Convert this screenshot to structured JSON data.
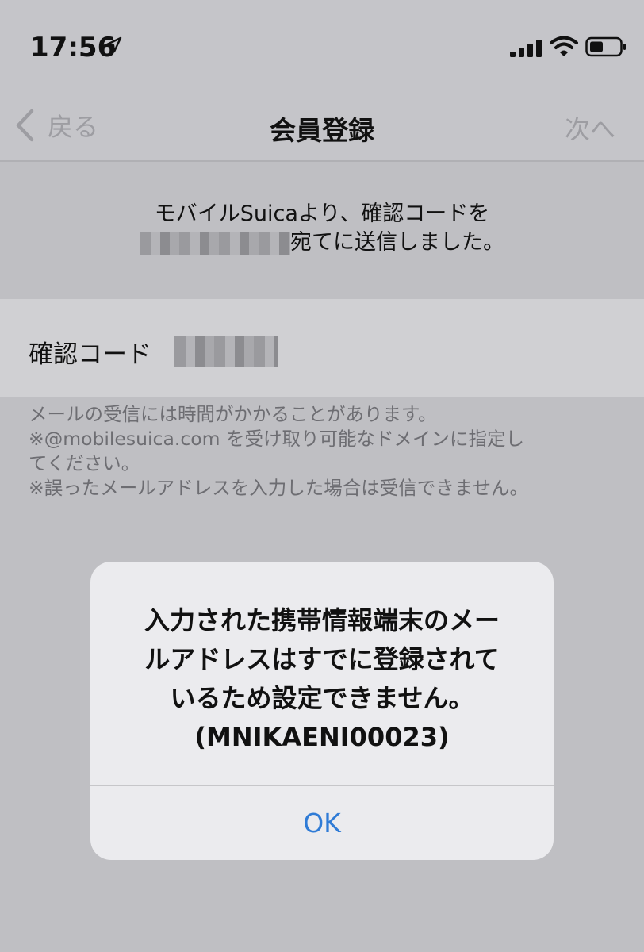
{
  "status_bar": {
    "time": "17:56",
    "icons": [
      "location-arrow-icon",
      "cellular-signal-icon",
      "wifi-icon",
      "battery-icon"
    ]
  },
  "nav": {
    "back_label": "戻る",
    "title": "会員登録",
    "next_label": "次へ"
  },
  "notice": {
    "line1": "モバイルSuicaより、確認コードを",
    "line2_suffix": "宛てに送信しました。"
  },
  "field": {
    "label": "確認コード"
  },
  "help": {
    "line1": "メールの受信には時間がかかることがあります。",
    "line2": "※@mobilesuica.com を受け取り可能なドメインに指定し",
    "line3": "てください。",
    "line4": "※誤ったメールアドレスを入力した場合は受信できません。"
  },
  "alert": {
    "line1": "入力された携帯情報端末のメー",
    "line2": "ルアドレスはすでに登録されて",
    "line3": "いるため設定できません。",
    "line4": "(MNIKAENI00023)",
    "ok_label": "OK"
  },
  "colors": {
    "background": "#c5c5c9",
    "alert_background": "#ebebee",
    "accent": "#2f7bd6",
    "muted_text": "#9d9da2"
  }
}
